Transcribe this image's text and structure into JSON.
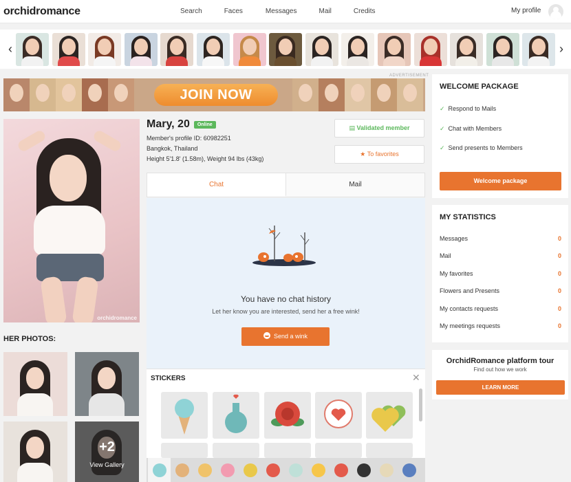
{
  "header": {
    "logo": "orchidromance",
    "nav": [
      "Search",
      "Faces",
      "Messages",
      "Mail",
      "Credits"
    ],
    "my_profile": "My profile"
  },
  "carousel": {
    "prev_icon": "chevron-left-icon",
    "next_icon": "chevron-right-icon",
    "thumb_count": 15
  },
  "ad": {
    "label": "ADVERTISEMENT",
    "join_label": "JOIN NOW"
  },
  "profile": {
    "name_age": "Mary, 20",
    "status": "Online",
    "profile_id": "Member's profile ID: 60982251",
    "location": "Bangkok, Thailand",
    "height_weight": "Height 5'1.8' (1.58m), Weight 94 lbs (43kg)",
    "validated_label": "Validated member",
    "favorites_label": "To favorites",
    "photo_watermark": "orchidromance"
  },
  "photos": {
    "title": "HER PHOTOS:",
    "more_count": "+2",
    "view_gallery": "View Gallery"
  },
  "tabs": {
    "chat": "Chat",
    "mail": "Mail"
  },
  "chat": {
    "empty_title": "You have no chat history",
    "empty_sub": "Let her know you are interested, send her a free wink!",
    "wink_label": "Send a wink"
  },
  "stickers": {
    "title": "STICKERS",
    "close_icon": "close-icon",
    "items": [
      "ice-cream-sticker",
      "potion-bottle-sticker",
      "rose-sticker",
      "heart-speech-bubble-sticker",
      "two-hearts-sticker"
    ]
  },
  "welcome": {
    "title": "WELCOME PACKAGE",
    "items": [
      "Respond to Mails",
      "Chat with Members",
      "Send presents to Members"
    ],
    "button": "Welcome package"
  },
  "stats": {
    "title": "MY STATISTICS",
    "rows": [
      {
        "label": "Messages",
        "value": "0"
      },
      {
        "label": "Mail",
        "value": "0"
      },
      {
        "label": "My favorites",
        "value": "0"
      },
      {
        "label": "Flowers and Presents",
        "value": "0"
      },
      {
        "label": "My contacts requests",
        "value": "0"
      },
      {
        "label": "My meetings requests",
        "value": "0"
      }
    ]
  },
  "tour": {
    "title": "OrchidRomance platform tour",
    "sub": "Find out how we work",
    "button": "LEARN MORE"
  },
  "colors": {
    "accent": "#e8742f",
    "online": "#5cb85c",
    "chat_bg": "#eaf2fa"
  }
}
